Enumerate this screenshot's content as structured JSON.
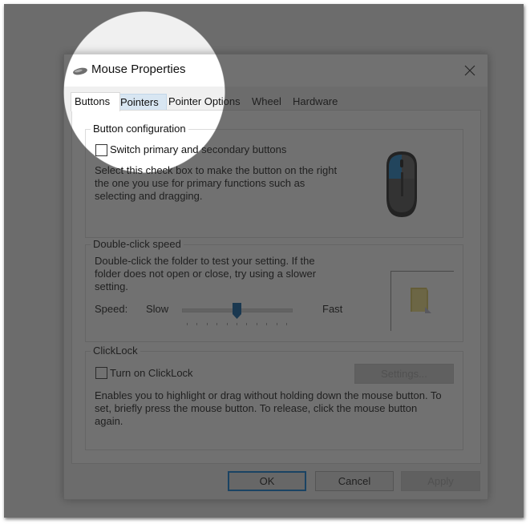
{
  "window": {
    "title": "Mouse Properties",
    "title_icon": "mouse-icon",
    "close_icon": "close-icon"
  },
  "tabs": [
    {
      "label": "Buttons",
      "active": true
    },
    {
      "label": "Pointers",
      "active": false,
      "hover": true
    },
    {
      "label": "Pointer Options",
      "active": false
    },
    {
      "label": "Wheel",
      "active": false
    },
    {
      "label": "Hardware",
      "active": false
    }
  ],
  "button_configuration": {
    "group_label": "Button configuration",
    "checkbox_label": "Switch primary and secondary buttons",
    "checked": false,
    "description": "Select this check box to make the button on the right the one you use for primary functions such as selecting and dragging.",
    "image_icon": "mouse-image-icon"
  },
  "double_click_speed": {
    "group_label": "Double-click speed",
    "description": "Double-click the folder to test your setting. If the folder does not open or close, try using a slower setting.",
    "speed_label": "Speed:",
    "slow_label": "Slow",
    "fast_label": "Fast",
    "slider": {
      "min": 0,
      "max": 10,
      "value": 5,
      "tick_count": 11
    },
    "folder_icon": "folder-icon"
  },
  "clicklock": {
    "group_label": "ClickLock",
    "checkbox_label": "Turn on ClickLock",
    "checked": false,
    "settings_label": "Settings...",
    "settings_enabled": false,
    "description": "Enables you to highlight or drag without holding down the mouse button. To set, briefly press the mouse button. To release, click the mouse button again."
  },
  "footer": {
    "ok_label": "OK",
    "cancel_label": "Cancel",
    "apply_label": "Apply",
    "apply_enabled": false
  },
  "colors": {
    "accent": "#0078d7",
    "slider_thumb": "#005a9e",
    "mouse_blue": "#1a7fc4",
    "folder": "#e8d36a"
  }
}
